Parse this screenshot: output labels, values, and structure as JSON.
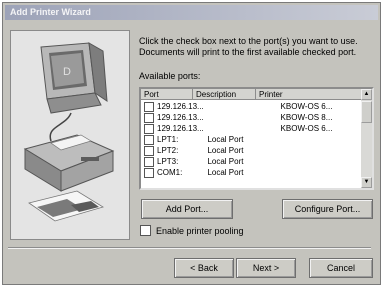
{
  "window": {
    "title": "Add Printer Wizard"
  },
  "instructions": "Click the check box next to the port(s) you want to use. Documents will print to the first available checked port.",
  "available_ports_label": "Available ports:",
  "ports": {
    "columns": [
      "Port",
      "Description",
      "Printer"
    ],
    "rows": [
      {
        "port": "129.126.13...",
        "description": "",
        "printer": "KBOW-OS 6..."
      },
      {
        "port": "129.126.13...",
        "description": "",
        "printer": "KBOW-OS 8..."
      },
      {
        "port": "129.126.13...",
        "description": "",
        "printer": "KBOW-OS 6..."
      },
      {
        "port": "LPT1:",
        "description": "Local Port",
        "printer": ""
      },
      {
        "port": "LPT2:",
        "description": "Local Port",
        "printer": ""
      },
      {
        "port": "LPT3:",
        "description": "Local Port",
        "printer": ""
      },
      {
        "port": "COM1:",
        "description": "Local Port",
        "printer": ""
      }
    ]
  },
  "buttons": {
    "add_port": "Add Port...",
    "configure_port": "Configure Port...",
    "back": "< Back",
    "next": "Next >",
    "cancel": "Cancel"
  },
  "pooling_label": "Enable printer pooling"
}
